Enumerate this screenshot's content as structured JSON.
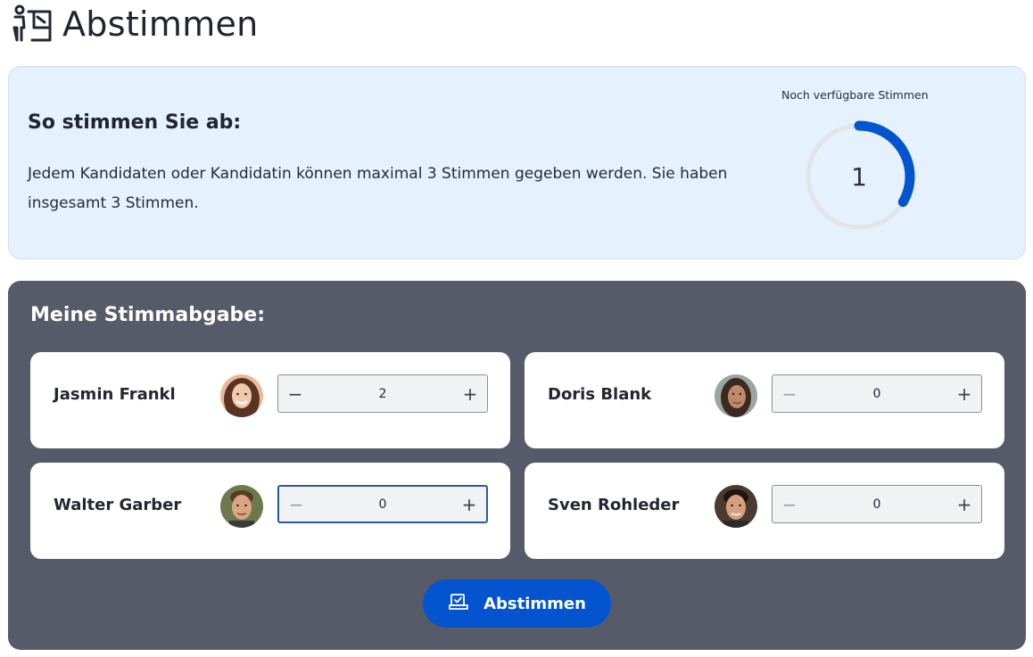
{
  "header": {
    "title": "Abstimmen",
    "icon": "voting-booth-icon"
  },
  "info": {
    "heading": "So stimmen Sie ab:",
    "text": "Jedem Kandidaten oder Kandidatin können maximal 3 Stimmen gegeben werden. Sie haben insgesamt 3 Stimmen.",
    "counter_label": "Noch verfügbare Stimmen",
    "remaining_votes": "1",
    "total_votes": 3,
    "ring_color": "#0453cf"
  },
  "ballot": {
    "heading": "Meine Stimmabgabe:",
    "candidates": [
      {
        "name": "Jasmin Frankl",
        "votes": "2",
        "minus": "−",
        "plus": "+"
      },
      {
        "name": "Doris Blank",
        "votes": "0",
        "minus": "−",
        "plus": "+"
      },
      {
        "name": "Walter Garber",
        "votes": "0",
        "minus": "−",
        "plus": "+"
      },
      {
        "name": "Sven Rohleder",
        "votes": "0",
        "minus": "−",
        "plus": "+"
      }
    ],
    "submit_label": "Abstimmen",
    "submit_icon": "ballot-box-icon"
  },
  "colors": {
    "accent": "#0453cf",
    "panel_bg": "#575a69",
    "info_bg": "#e5f1fc"
  }
}
